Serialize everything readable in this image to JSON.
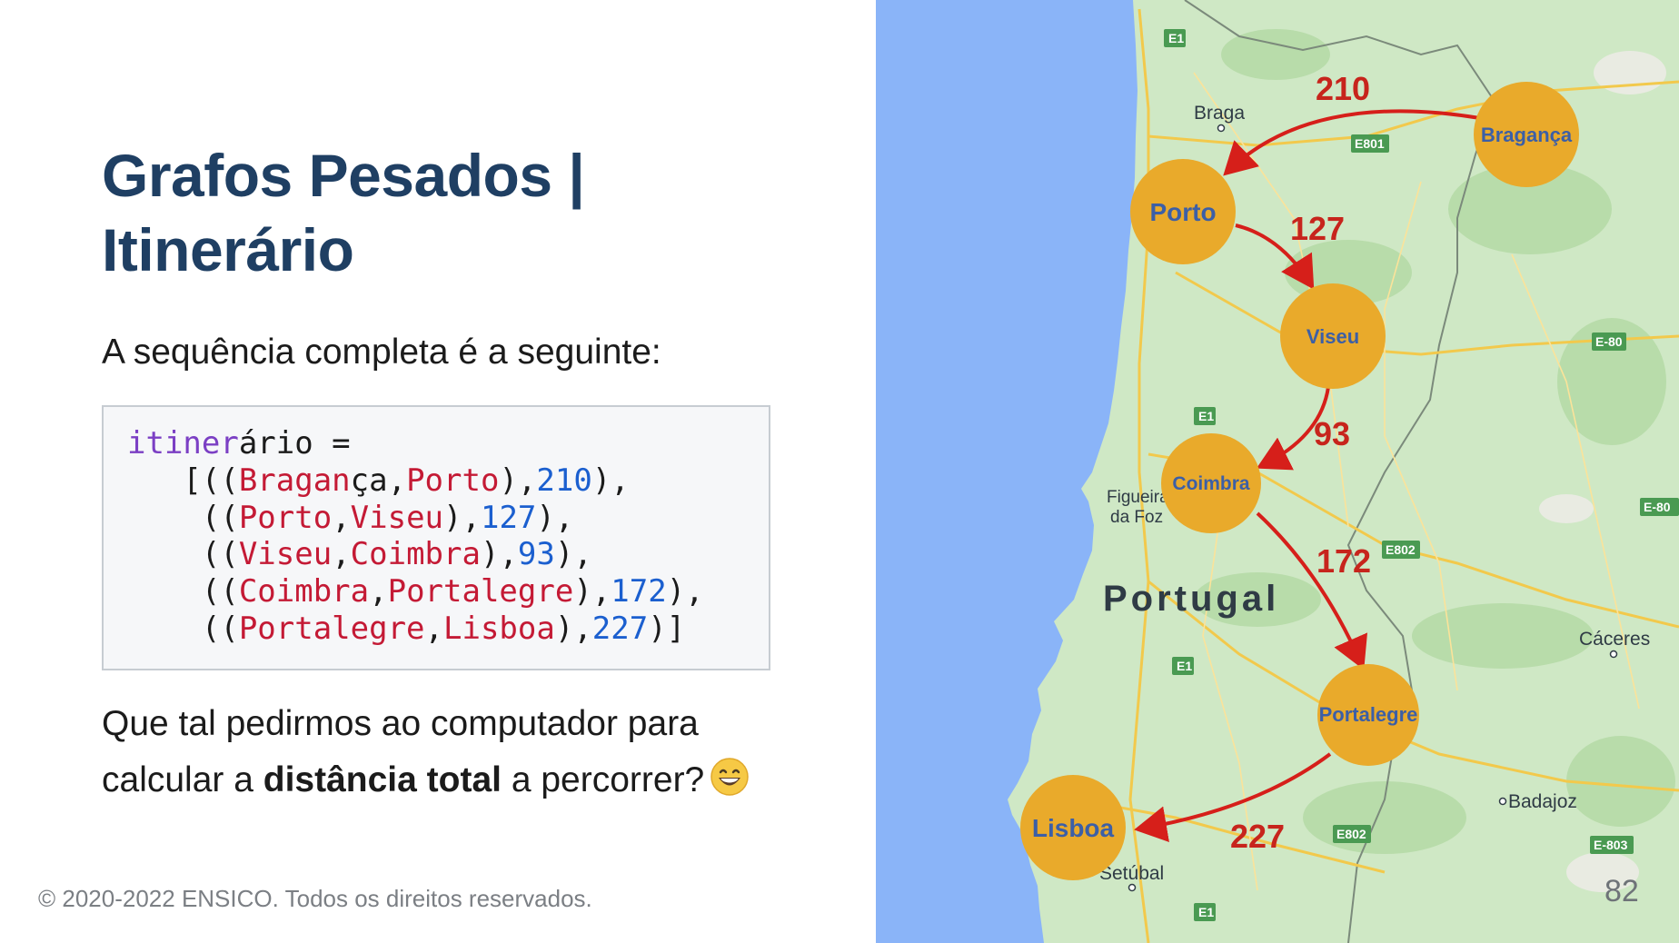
{
  "slide": {
    "title_line1": "Grafos Pesados |",
    "title_line2": "Itinerário",
    "intro": "A sequência completa é a seguinte:",
    "question_part1": "Que tal pedirmos ao computador para calcular a ",
    "question_bold": "distância total",
    "question_part2": " a percorrer?",
    "emoji_icon": "grinning-face-icon",
    "footer": "© 2020-2022 ENSICO. Todos os direitos reservados.",
    "page_number": "82"
  },
  "code": {
    "lines": [
      [
        {
          "t": "itiner",
          "c": "kw"
        },
        {
          "t": "ário =",
          "c": "plain"
        }
      ],
      [
        {
          "t": "   [((",
          "c": "plain"
        },
        {
          "t": "Bragan",
          "c": "str"
        },
        {
          "t": "ça,",
          "c": "plain"
        },
        {
          "t": "Porto",
          "c": "str"
        },
        {
          "t": "),",
          "c": "plain"
        },
        {
          "t": "210",
          "c": "num"
        },
        {
          "t": "),",
          "c": "plain"
        }
      ],
      [
        {
          "t": "    ((",
          "c": "plain"
        },
        {
          "t": "Porto",
          "c": "str"
        },
        {
          "t": ",",
          "c": "plain"
        },
        {
          "t": "Viseu",
          "c": "str"
        },
        {
          "t": "),",
          "c": "plain"
        },
        {
          "t": "127",
          "c": "num"
        },
        {
          "t": "),",
          "c": "plain"
        }
      ],
      [
        {
          "t": "    ((",
          "c": "plain"
        },
        {
          "t": "Viseu",
          "c": "str"
        },
        {
          "t": ",",
          "c": "plain"
        },
        {
          "t": "Coimbra",
          "c": "str"
        },
        {
          "t": "),",
          "c": "plain"
        },
        {
          "t": "93",
          "c": "num"
        },
        {
          "t": "),",
          "c": "plain"
        }
      ],
      [
        {
          "t": "    ((",
          "c": "plain"
        },
        {
          "t": "Coimbra",
          "c": "str"
        },
        {
          "t": ",",
          "c": "plain"
        },
        {
          "t": "Portalegre",
          "c": "str"
        },
        {
          "t": "),",
          "c": "plain"
        },
        {
          "t": "172",
          "c": "num"
        },
        {
          "t": "),",
          "c": "plain"
        }
      ],
      [
        {
          "t": "    ((",
          "c": "plain"
        },
        {
          "t": "Portalegre",
          "c": "str"
        },
        {
          "t": ",",
          "c": "plain"
        },
        {
          "t": "Lisboa",
          "c": "str"
        },
        {
          "t": "),",
          "c": "plain"
        },
        {
          "t": "227",
          "c": "num"
        },
        {
          "t": ")]",
          "c": "plain"
        }
      ]
    ]
  },
  "map": {
    "country_label": "Portugal",
    "places": [
      "Braga",
      "Figueira da Foz",
      "Cáceres",
      "Badajoz",
      "Setúbal"
    ],
    "place_figueira_line1": "Figueira",
    "place_figueira_line2": "da Foz",
    "roads": [
      "E1",
      "E1",
      "E1",
      "E1",
      "E801",
      "E802",
      "E802",
      "E-80",
      "E-80",
      "E-803"
    ],
    "cities": [
      "Bragança",
      "Porto",
      "Viseu",
      "Coimbra",
      "Portalegre",
      "Lisboa"
    ],
    "distances": [
      "210",
      "127",
      "93",
      "172",
      "227"
    ],
    "colors": {
      "sea": "#8ab4f8",
      "land": "#cfe8c5",
      "node": "#e9aa2b",
      "node_text": "#3c5fa6",
      "edge": "#d61f1a",
      "title": "#1f3f63"
    }
  }
}
